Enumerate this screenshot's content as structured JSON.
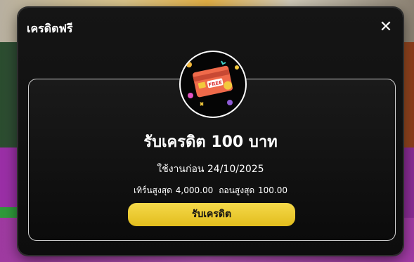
{
  "modal": {
    "title": "เครดิตฟรี",
    "close_label": "✕",
    "headline": "รับเครดิต 100 บาท",
    "use_before": "ใช้งานก่อน 24/10/2025",
    "max_top_up": "เทิร์นสูงสุด 4,000.00",
    "max_withdraw": "ถอนสูงสุด 100.00",
    "claim_button": "รับเครดิต",
    "card_badge": "FREE"
  },
  "colors": {
    "modal_bg": "#0d0d0d",
    "button_yellow": "#f0d233",
    "card_orange": "#ef6a4a"
  }
}
